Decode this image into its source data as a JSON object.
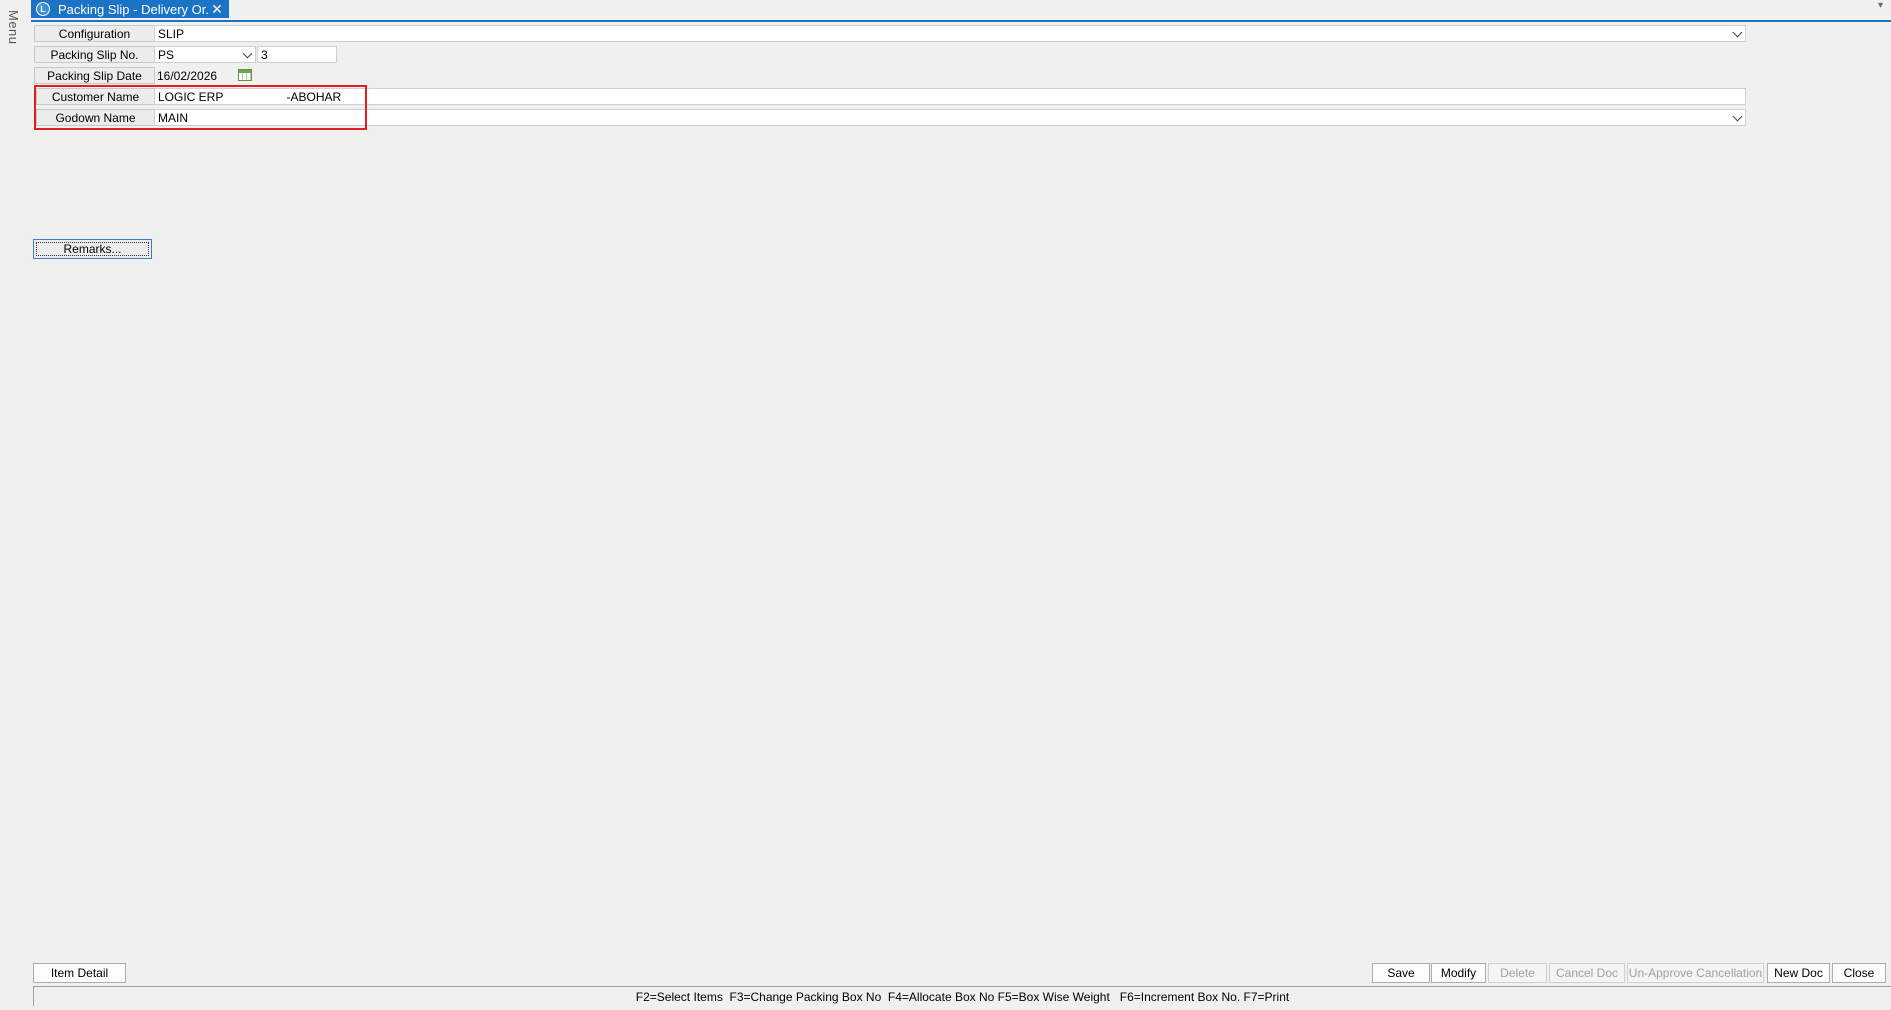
{
  "menu": {
    "label": "Menu"
  },
  "tab": {
    "icon": "app-logo-icon",
    "title": "Packing Slip - Delivery Or...",
    "close": "✕"
  },
  "form": {
    "configuration": {
      "label": "Configuration",
      "value": "SLIP"
    },
    "packing_slip_no": {
      "label": "Packing Slip No.",
      "series": "PS",
      "number": "3"
    },
    "packing_slip_date": {
      "label": "Packing Slip Date",
      "value": "16/02/2026"
    },
    "customer_name": {
      "label": "Customer Name",
      "value": "LOGIC ERP                   -ABOHAR"
    },
    "godown_name": {
      "label": "Godown Name",
      "value": "MAIN"
    }
  },
  "buttons": {
    "remarks": "Remarks...",
    "item_detail": "Item Detail",
    "save": "Save",
    "modify": "Modify",
    "delete": "Delete",
    "cancel_doc": "Cancel Doc",
    "unapprove_cancellation": "Un-Approve Cancellation",
    "new_doc": "New Doc",
    "close": "Close"
  },
  "status": {
    "shortcuts": "F2=Select Items  F3=Change Packing Box No  F4=Allocate Box No F5=Box Wise Weight   F6=Increment Box No. F7=Print"
  },
  "colors": {
    "accent": "#1a73c4",
    "highlight": "#e02020",
    "background": "#f0f0f0"
  }
}
